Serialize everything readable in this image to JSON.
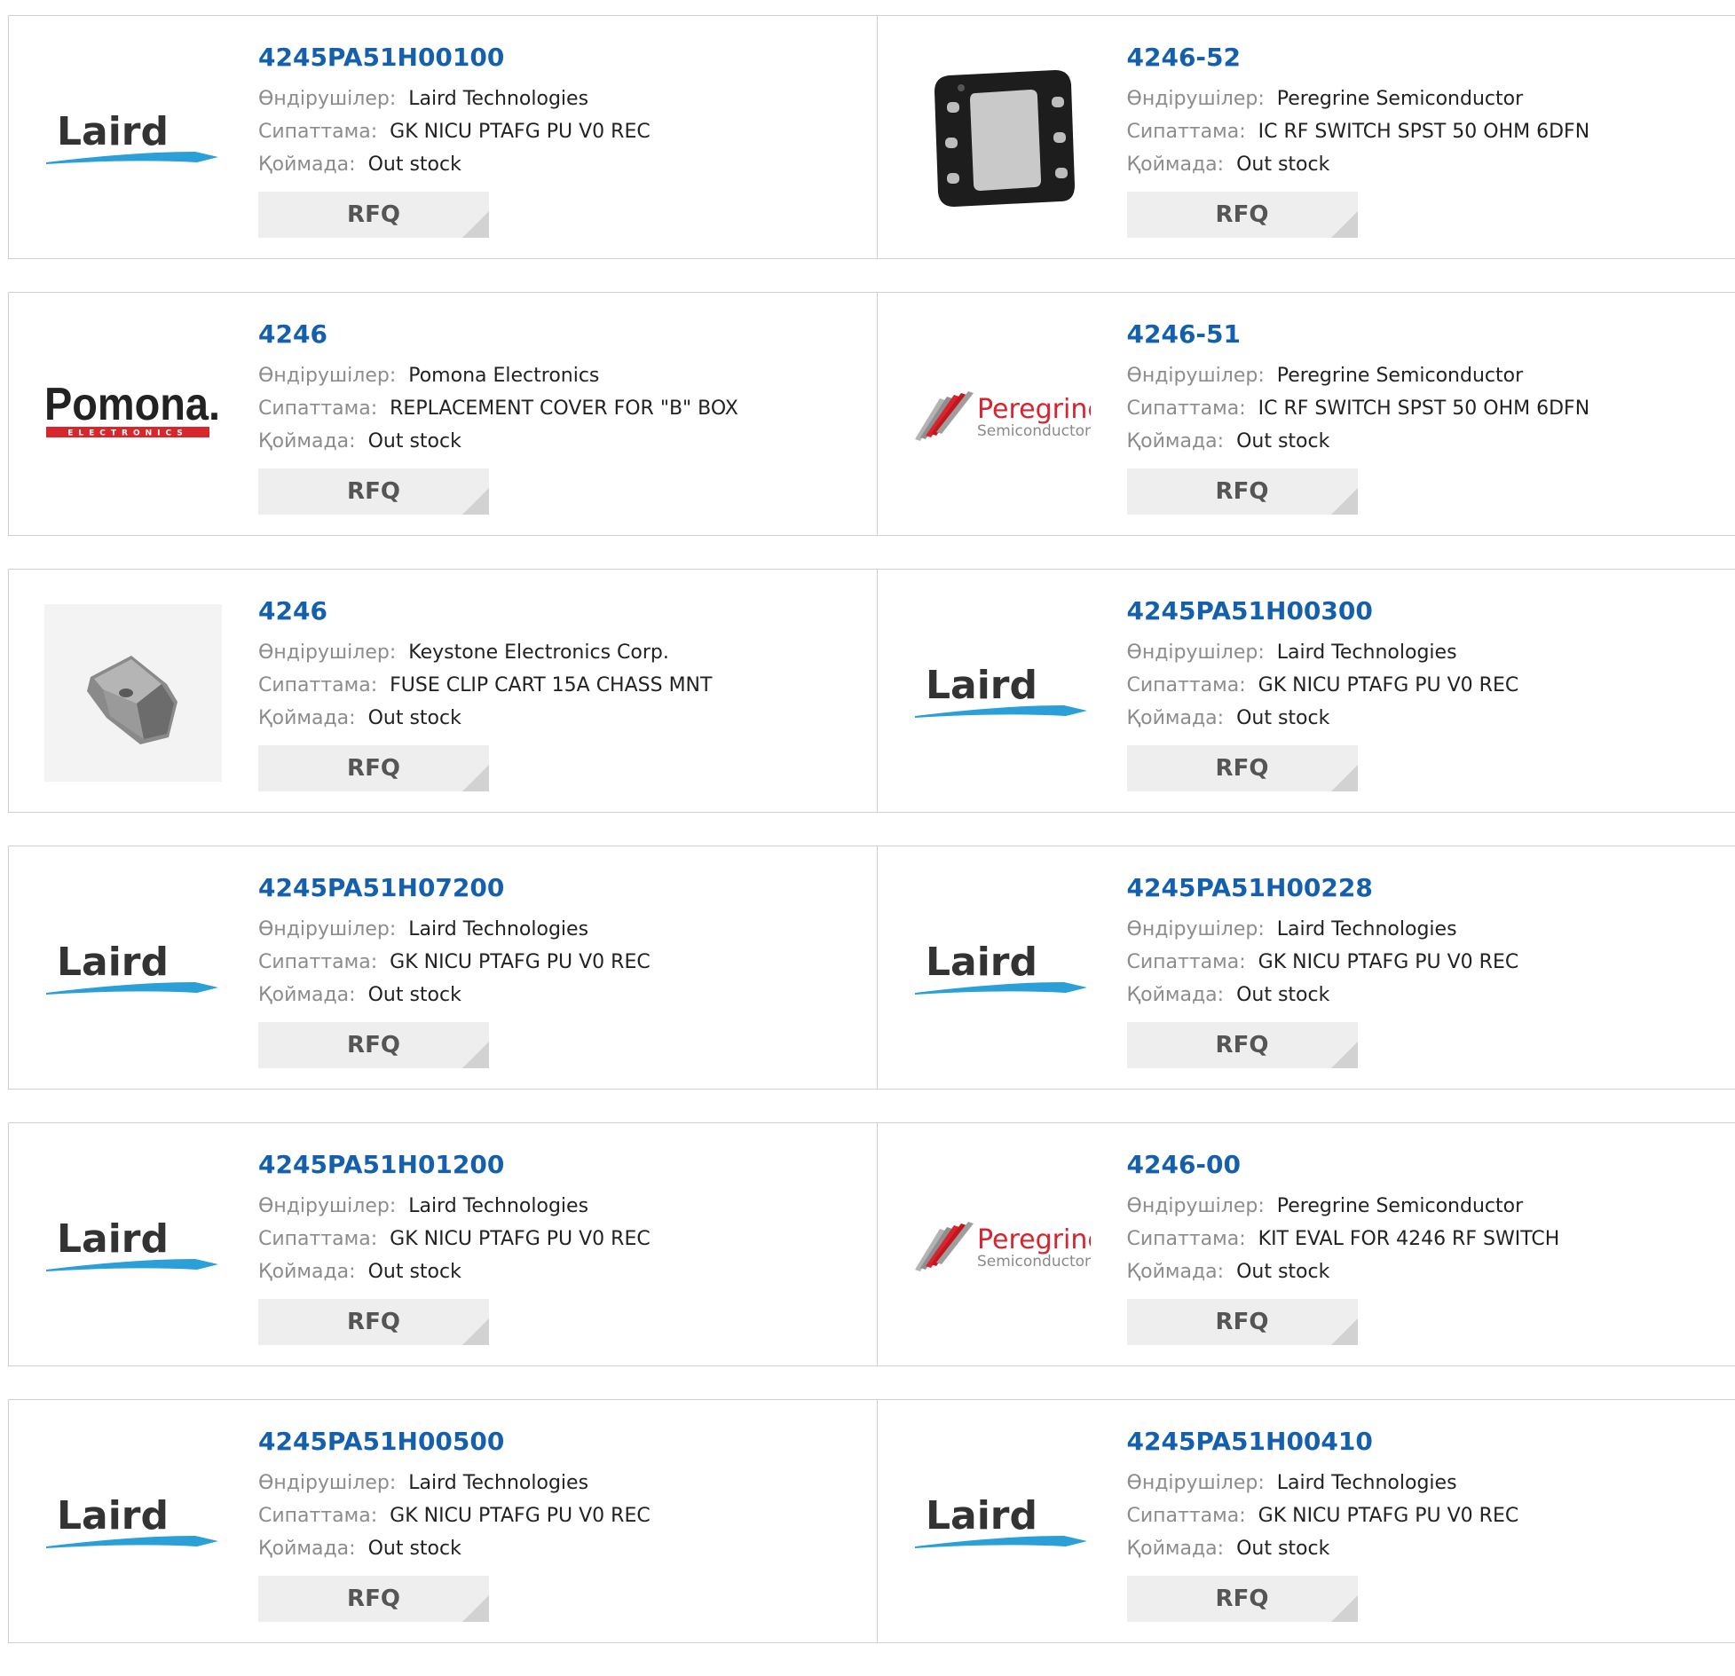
{
  "labels": {
    "manufacturer": "Өндірушілер:",
    "description": "Сипаттама:",
    "stock": "Қоймада:",
    "rfq": "RFQ"
  },
  "products": [
    {
      "part": "4245PA51H00100",
      "manufacturer": "Laird Technologies",
      "description": "GK NICU PTAFG PU V0 REC",
      "stock": "Out stock",
      "logo": "laird-logo"
    },
    {
      "part": "4246-52",
      "manufacturer": "Peregrine Semiconductor",
      "description": "IC RF SWITCH SPST 50 OHM 6DFN",
      "stock": "Out stock",
      "logo": "dfn-chip-image"
    },
    {
      "part": "4246",
      "manufacturer": "Pomona Electronics",
      "description": "REPLACEMENT COVER FOR \"B\" BOX",
      "stock": "Out stock",
      "logo": "pomona-logo"
    },
    {
      "part": "4246-51",
      "manufacturer": "Peregrine Semiconductor",
      "description": "IC RF SWITCH SPST 50 OHM 6DFN",
      "stock": "Out stock",
      "logo": "peregrine-logo"
    },
    {
      "part": "4246",
      "manufacturer": "Keystone Electronics Corp.",
      "description": "FUSE CLIP CART 15A CHASS MNT",
      "stock": "Out stock",
      "logo": "fuse-clip-image"
    },
    {
      "part": "4245PA51H00300",
      "manufacturer": "Laird Technologies",
      "description": "GK NICU PTAFG PU V0 REC",
      "stock": "Out stock",
      "logo": "laird-logo"
    },
    {
      "part": "4245PA51H07200",
      "manufacturer": "Laird Technologies",
      "description": "GK NICU PTAFG PU V0 REC",
      "stock": "Out stock",
      "logo": "laird-logo"
    },
    {
      "part": "4245PA51H00228",
      "manufacturer": "Laird Technologies",
      "description": "GK NICU PTAFG PU V0 REC",
      "stock": "Out stock",
      "logo": "laird-logo"
    },
    {
      "part": "4245PA51H01200",
      "manufacturer": "Laird Technologies",
      "description": "GK NICU PTAFG PU V0 REC",
      "stock": "Out stock",
      "logo": "laird-logo"
    },
    {
      "part": "4246-00",
      "manufacturer": "Peregrine Semiconductor",
      "description": "KIT EVAL FOR 4246 RF SWITCH",
      "stock": "Out stock",
      "logo": "peregrine-logo"
    },
    {
      "part": "4245PA51H00500",
      "manufacturer": "Laird Technologies",
      "description": "GK NICU PTAFG PU V0 REC",
      "stock": "Out stock",
      "logo": "laird-logo"
    },
    {
      "part": "4245PA51H00410",
      "manufacturer": "Laird Technologies",
      "description": "GK NICU PTAFG PU V0 REC",
      "stock": "Out stock",
      "logo": "laird-logo"
    }
  ],
  "logo_text": {
    "laird": "Laird",
    "pomona": "Pomona.",
    "pomona_sub": "ELECTRONICS",
    "peregrine": "Peregrine",
    "peregrine_sub": "Semiconductor"
  },
  "colors": {
    "link": "#1560ac",
    "label": "#8c8c8c",
    "value": "#222222",
    "rfq_bg": "#eeeeee",
    "laird_blue": "#2a9fd8",
    "pomona_red": "#d7262c",
    "peregrine_red": "#d9232e"
  }
}
